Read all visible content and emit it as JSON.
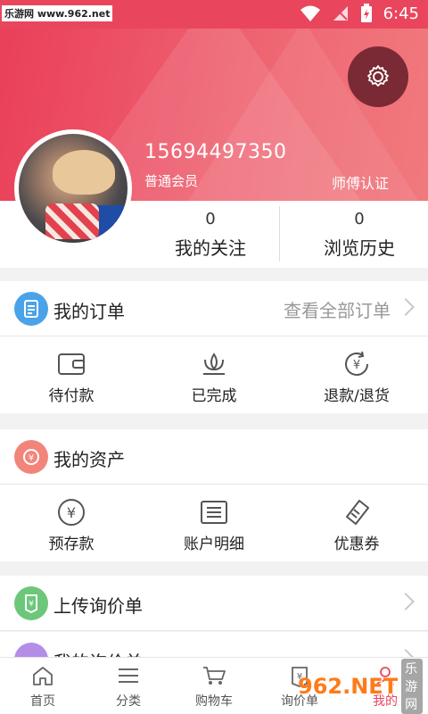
{
  "status_bar": {
    "watermark": "乐游网 www.962.net",
    "time": "6:45"
  },
  "profile": {
    "phone": "15694497350",
    "member_level": "普通会员",
    "certification": "师傅认证",
    "stats": [
      {
        "count": "0",
        "label": "我的关注"
      },
      {
        "count": "0",
        "label": "浏览历史"
      }
    ]
  },
  "orders": {
    "title": "我的订单",
    "view_all": "查看全部订单",
    "items": [
      {
        "label": "待付款",
        "icon": "wallet-icon"
      },
      {
        "label": "已完成",
        "icon": "lotus-icon"
      },
      {
        "label": "退款/退货",
        "icon": "refund-icon"
      }
    ]
  },
  "assets": {
    "title": "我的资产",
    "items": [
      {
        "label": "预存款",
        "icon": "yen-coin-icon"
      },
      {
        "label": "账户明细",
        "icon": "receipt-icon"
      },
      {
        "label": "优惠券",
        "icon": "coupon-icon"
      }
    ]
  },
  "upload_inquiry": {
    "title": "上传询价单"
  },
  "my_inquiry": {
    "title": "我的询价单"
  },
  "bottom_nav": [
    {
      "label": "首页",
      "icon": "home-icon"
    },
    {
      "label": "分类",
      "icon": "list-icon"
    },
    {
      "label": "购物车",
      "icon": "cart-icon"
    },
    {
      "label": "询价单",
      "icon": "price-tag-icon"
    },
    {
      "label": "我的",
      "icon": "user-icon"
    }
  ],
  "watermark_br": {
    "logo": "962.NET",
    "text": "乐游网"
  },
  "colors": {
    "header": "#ea3f5a",
    "order_icon": "#4aa3e8",
    "asset_icon": "#f2857a",
    "upload_icon": "#6cc77a",
    "inquiry_icon": "#b48de8"
  }
}
